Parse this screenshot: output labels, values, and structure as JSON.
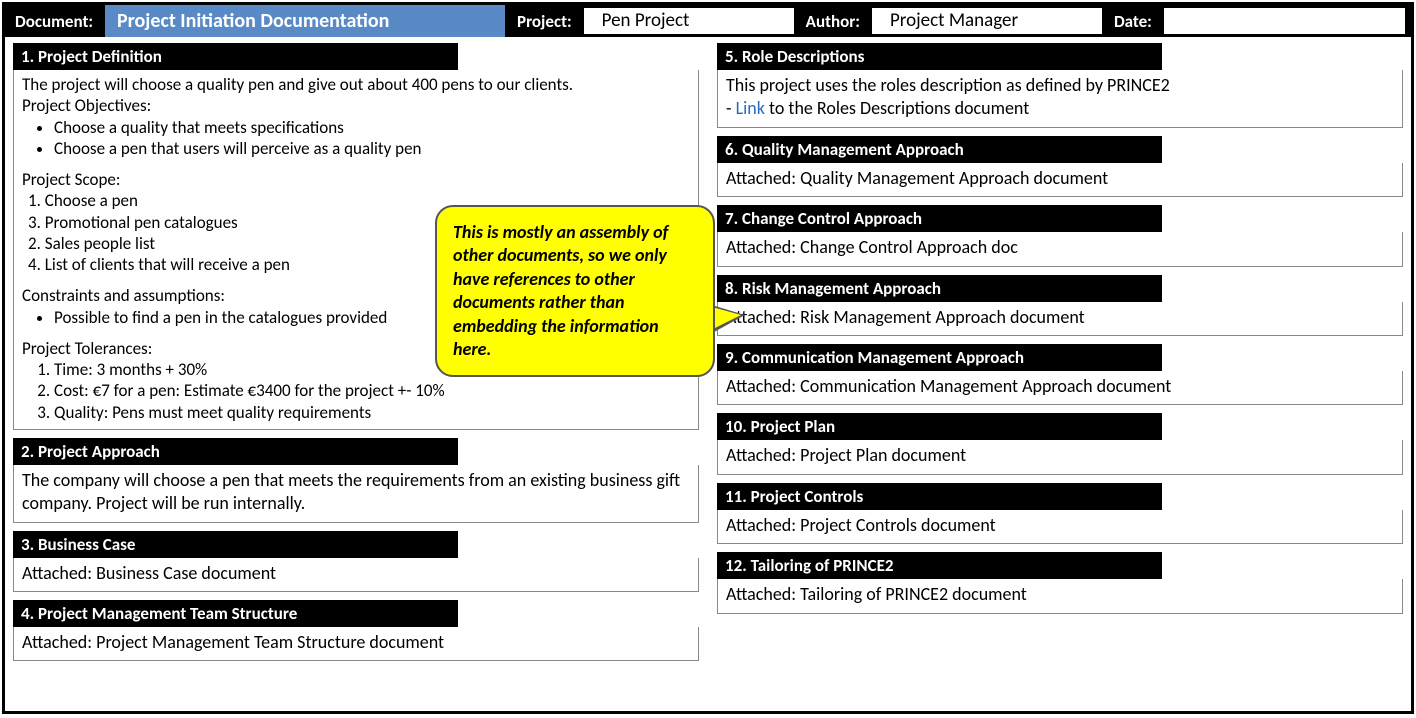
{
  "top": {
    "document_label": "Document:",
    "document_title": "Project Initiation Documentation",
    "project_label": "Project:",
    "project_value": "Pen Project",
    "author_label": "Author:",
    "author_value": "Project Manager",
    "date_label": "Date:",
    "date_value": ""
  },
  "callout": {
    "text": "This is mostly an assembly of other documents, so we only have references to other documents rather than embedding the information here."
  },
  "s1": {
    "header": "1. Project Definition",
    "intro": "The project will choose a quality pen and give out about 400 pens to our clients.",
    "objectives_label": "Project Objectives:",
    "objectives": [
      "Choose a quality that meets specifications",
      "Choose a pen that users will perceive as a quality pen"
    ],
    "scope_label": "Project Scope:",
    "scope": [
      "Choose a pen",
      "Promotional pen catalogues",
      "Sales people list",
      "List of clients that will receive a pen"
    ],
    "constraints_label": "Constraints and assumptions:",
    "constraints": [
      "Possible to find a pen in the catalogues provided"
    ],
    "tolerances_label": "Project Tolerances:",
    "tolerances": [
      "Time: 3 months + 30%",
      "Cost: €7 for a pen: Estimate €3400 for the project +- 10%",
      "Quality: Pens must meet quality requirements"
    ]
  },
  "s2": {
    "header": "2. Project Approach",
    "body": "The company will choose a pen that meets the requirements from an existing business gift company. Project will be run internally."
  },
  "s3": {
    "header": "3. Business Case",
    "body": "Attached: Business Case document"
  },
  "s4": {
    "header": "4. Project Management Team Structure",
    "body": "Attached: Project Management Team Structure document"
  },
  "s5": {
    "header": "5. Role Descriptions",
    "line1": "This project uses the roles description as defined by PRINCE2",
    "link_prefix": "- ",
    "link_text": "Link",
    "link_suffix": " to the Roles Descriptions document"
  },
  "s6": {
    "header": "6. Quality Management Approach",
    "body": "Attached: Quality Management Approach document"
  },
  "s7": {
    "header": "7. Change Control Approach",
    "body": "Attached: Change Control Approach doc"
  },
  "s8": {
    "header": "8. Risk Management Approach",
    "body": "Attached: Risk Management Approach document"
  },
  "s9": {
    "header": "9. Communication Management Approach",
    "body": "Attached: Communication Management Approach document"
  },
  "s10": {
    "header": "10. Project Plan",
    "body": "Attached: Project Plan document"
  },
  "s11": {
    "header": "11. Project Controls",
    "body": "Attached: Project Controls document"
  },
  "s12": {
    "header": "12. Tailoring of PRINCE2",
    "body": "Attached: Tailoring of PRINCE2 document"
  }
}
